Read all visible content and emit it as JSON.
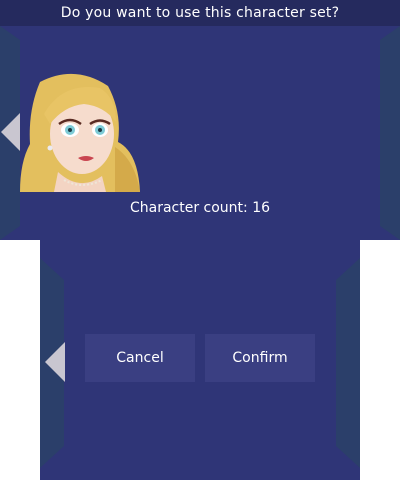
{
  "dialog": {
    "question": "Do you want to use this character set?",
    "character_count": "Character count: 16",
    "cancel_label": "Cancel",
    "confirm_label": "Confirm"
  },
  "colors": {
    "background": "#2f3577",
    "title_bar": "#252a5e",
    "side_panel": "#2b3f6a",
    "button": "#3a3f82",
    "arrow": "#c9c6d0",
    "text": "#ffffff"
  },
  "icons": {
    "top_arrow": "triangle-left-icon",
    "bottom_arrow": "triangle-left-icon"
  }
}
